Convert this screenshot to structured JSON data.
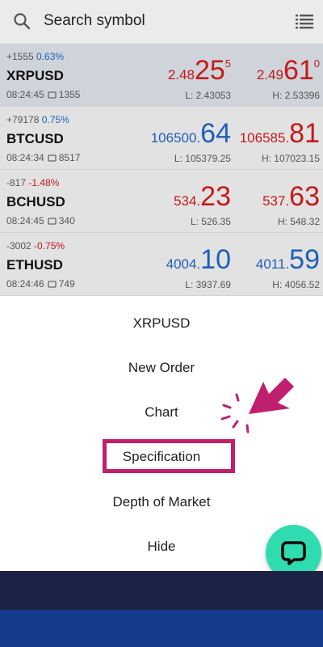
{
  "search": {
    "placeholder": "Search symbol"
  },
  "quotes": [
    {
      "change": "+1555",
      "change_pct": "0.63%",
      "symbol": "XRPUSD",
      "time": "08:24:45",
      "spread": "1355",
      "bid": {
        "prefix": "2.48",
        "big": "25",
        "sup": "5"
      },
      "ask": {
        "prefix": "2.49",
        "big": "61",
        "sup": "0"
      },
      "low": "L: 2.43053",
      "high": "H: 2.53396"
    },
    {
      "change": "+79178",
      "change_pct": "0.75%",
      "symbol": "BTCUSD",
      "time": "08:24:34",
      "spread": "8517",
      "bid": {
        "prefix": "106500.",
        "big": "64",
        "sup": ""
      },
      "ask": {
        "prefix": "106585.",
        "big": "81",
        "sup": ""
      },
      "low": "L: 105379.25",
      "high": "H: 107023.15"
    },
    {
      "change": "-817",
      "change_pct": "-1.48%",
      "symbol": "BCHUSD",
      "time": "08:24:45",
      "spread": "340",
      "bid": {
        "prefix": "534.",
        "big": "23",
        "sup": ""
      },
      "ask": {
        "prefix": "537.",
        "big": "63",
        "sup": ""
      },
      "low": "L: 526.35",
      "high": "H: 548.32"
    },
    {
      "change": "-3002",
      "change_pct": "-0.75%",
      "symbol": "ETHUSD",
      "time": "08:24:46",
      "spread": "749",
      "bid": {
        "prefix": "4004.",
        "big": "10",
        "sup": ""
      },
      "ask": {
        "prefix": "4011.",
        "big": "59",
        "sup": ""
      },
      "low": "L: 3937.69",
      "high": "H: 4056.52"
    }
  ],
  "menu": {
    "title": "XRPUSD",
    "items": [
      "New Order",
      "Chart",
      "Specification",
      "Depth of Market",
      "Hide"
    ],
    "highlighted": "Specification"
  },
  "colors": {
    "price_up": "#1f5fb8",
    "price_down": "#c41a1a",
    "highlight_border": "#bf1f6c",
    "chat_button": "#2fdcb0",
    "band_dark": "#1c2245",
    "band_blue": "#163a8c"
  },
  "icons": {
    "search": "search-icon",
    "list": "list-icon",
    "chat": "chat-icon",
    "pointer": "arrow-pointer-icon"
  }
}
